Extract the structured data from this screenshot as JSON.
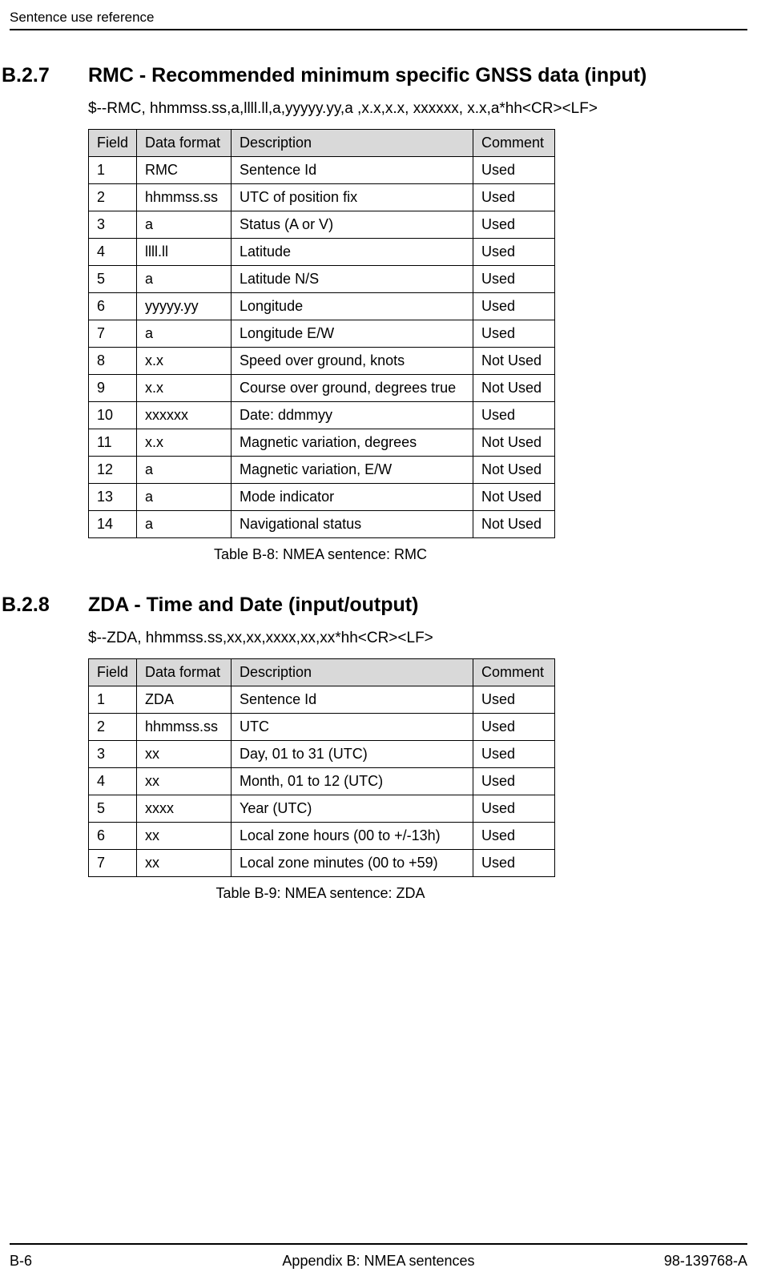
{
  "header": {
    "running": "Sentence use reference"
  },
  "sections": [
    {
      "num": "B.2.7",
      "title": "RMC - Recommended minimum specific GNSS data (input)",
      "sentence": "$--RMC, hhmmss.ss,a,llll.ll,a,yyyyy.yy,a ,x.x,x.x, xxxxxx, x.x,a*hh<CR><LF>",
      "caption": "Table B-8: NMEA sentence: RMC",
      "cols": {
        "c1": "Field",
        "c2": "Data format",
        "c3": "Description",
        "c4": "Comment"
      },
      "rows": [
        {
          "f": "1",
          "fmt": "RMC",
          "desc": "Sentence Id",
          "cm": "Used"
        },
        {
          "f": "2",
          "fmt": "hhmmss.ss",
          "desc": "UTC of position fix",
          "cm": "Used"
        },
        {
          "f": "3",
          "fmt": "a",
          "desc": "Status (A or V)",
          "cm": "Used"
        },
        {
          "f": "4",
          "fmt": "llll.ll",
          "desc": "Latitude",
          "cm": "Used"
        },
        {
          "f": "5",
          "fmt": "a",
          "desc": "Latitude N/S",
          "cm": "Used"
        },
        {
          "f": "6",
          "fmt": "yyyyy.yy",
          "desc": "Longitude",
          "cm": "Used"
        },
        {
          "f": "7",
          "fmt": "a",
          "desc": "Longitude E/W",
          "cm": "Used"
        },
        {
          "f": "8",
          "fmt": "x.x",
          "desc": "Speed over ground, knots",
          "cm": "Not Used"
        },
        {
          "f": "9",
          "fmt": "x.x",
          "desc": "Course over ground, degrees true",
          "cm": "Not Used"
        },
        {
          "f": "10",
          "fmt": "xxxxxx",
          "desc": "Date: ddmmyy",
          "cm": "Used"
        },
        {
          "f": "11",
          "fmt": "x.x",
          "desc": "Magnetic variation, degrees",
          "cm": "Not Used"
        },
        {
          "f": "12",
          "fmt": "a",
          "desc": "Magnetic variation, E/W",
          "cm": "Not Used"
        },
        {
          "f": "13",
          "fmt": "a",
          "desc": "Mode indicator",
          "cm": "Not Used"
        },
        {
          "f": "14",
          "fmt": "a",
          "desc": "Navigational status",
          "cm": "Not Used"
        }
      ]
    },
    {
      "num": "B.2.8",
      "title": "ZDA - Time and Date (input/output)",
      "sentence": "$--ZDA, hhmmss.ss,xx,xx,xxxx,xx,xx*hh<CR><LF>",
      "caption": "Table B-9: NMEA sentence: ZDA",
      "cols": {
        "c1": "Field",
        "c2": "Data format",
        "c3": "Description",
        "c4": "Comment"
      },
      "rows": [
        {
          "f": "1",
          "fmt": "ZDA",
          "desc": "Sentence Id",
          "cm": "Used"
        },
        {
          "f": "2",
          "fmt": "hhmmss.ss",
          "desc": "UTC",
          "cm": "Used"
        },
        {
          "f": "3",
          "fmt": "xx",
          "desc": "Day, 01 to 31 (UTC)",
          "cm": "Used"
        },
        {
          "f": "4",
          "fmt": "xx",
          "desc": "Month, 01 to 12 (UTC)",
          "cm": "Used"
        },
        {
          "f": "5",
          "fmt": "xxxx",
          "desc": "Year  (UTC)",
          "cm": "Used"
        },
        {
          "f": "6",
          "fmt": "xx",
          "desc": "Local zone hours (00 to +/-13h)",
          "cm": "Used"
        },
        {
          "f": "7",
          "fmt": "xx",
          "desc": "Local zone minutes (00 to +59)",
          "cm": "Used"
        }
      ]
    }
  ],
  "footer": {
    "left": "B-6",
    "center": "Appendix B:  NMEA sentences",
    "right": "98-139768-A"
  }
}
